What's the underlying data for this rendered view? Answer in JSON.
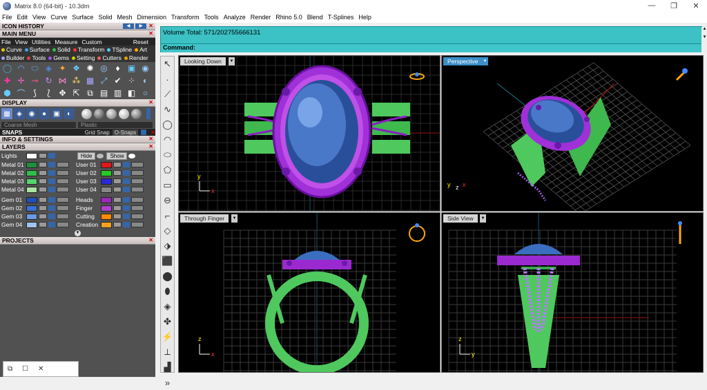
{
  "window": {
    "title": "Matrix 8.0 (64-bit) - 10.3dm",
    "minimize": "—",
    "maximize": "❐",
    "close": "✕"
  },
  "menu": [
    "File",
    "Edit",
    "View",
    "Curve",
    "Surface",
    "Solid",
    "Mesh",
    "Dimension",
    "Transform",
    "Tools",
    "Analyze",
    "Render",
    "Rhino 5.0",
    "Blend",
    "T-Splines",
    "Help"
  ],
  "panel": {
    "icon_history": "ICON HISTORY",
    "main_menu": "MAIN MENU",
    "tabs": [
      "File",
      "View",
      "Utilities",
      "Measure",
      "Custom"
    ],
    "reset": "Reset",
    "cat_row1": [
      "Curve",
      "Surface",
      "Solid",
      "Transform",
      "TSpline",
      "Art"
    ],
    "cat_row2": [
      "Builder",
      "Tools",
      "Gems",
      "Setting",
      "Cutters",
      "Render"
    ],
    "display": "DISPLAY",
    "display_mode": "Coarse Mesh",
    "material": "Plastic",
    "snaps": "SNAPS",
    "grid_snap": "Grid Snap",
    "o_snaps": "O-Snaps",
    "info": "INFO & SETTINGS",
    "layers": "LAYERS",
    "lights": "Lights",
    "hide": "Hide",
    "show": "Show",
    "projects": "PROJECTS",
    "layer_rows": [
      {
        "left": "Metal 01",
        "lc": "#1f8f3a",
        "right": "User 01",
        "rc": "#e01818"
      },
      {
        "left": "Metal 02",
        "lc": "#2fbf4a",
        "right": "User 02",
        "rc": "#22cc22"
      },
      {
        "left": "Metal 03",
        "lc": "#55d46a",
        "right": "User 03",
        "rc": "#2a2ad8"
      },
      {
        "left": "Metal 04",
        "lc": "#a9e4a0",
        "right": "User 04",
        "rc": "#888888"
      },
      {
        "left": "Gem 01",
        "lc": "#2050b8",
        "right": "Heads",
        "rc": "#9a2ab8"
      },
      {
        "left": "Gem 02",
        "lc": "#3a70d8",
        "right": "Finger",
        "rc": "#b040d0"
      },
      {
        "left": "Gem 03",
        "lc": "#6a9ae8",
        "right": "Cutting",
        "rc": "#ff8a00"
      },
      {
        "left": "Gem 04",
        "lc": "#a0c4f0",
        "right": "Creation",
        "rc": "#ffa020"
      }
    ]
  },
  "command": {
    "volume": "Volume Total: 571/202755666131",
    "label": "Command:"
  },
  "viewports": {
    "top_left": "Looking Down",
    "top_right": "Perspective",
    "bottom_left": "Through Finger",
    "bottom_right": "Side View"
  },
  "colors": {
    "accent": "#3cc1c5",
    "gem": "#3a6fc0",
    "metal": "#5cd36a",
    "halo": "#9a2ad0"
  }
}
